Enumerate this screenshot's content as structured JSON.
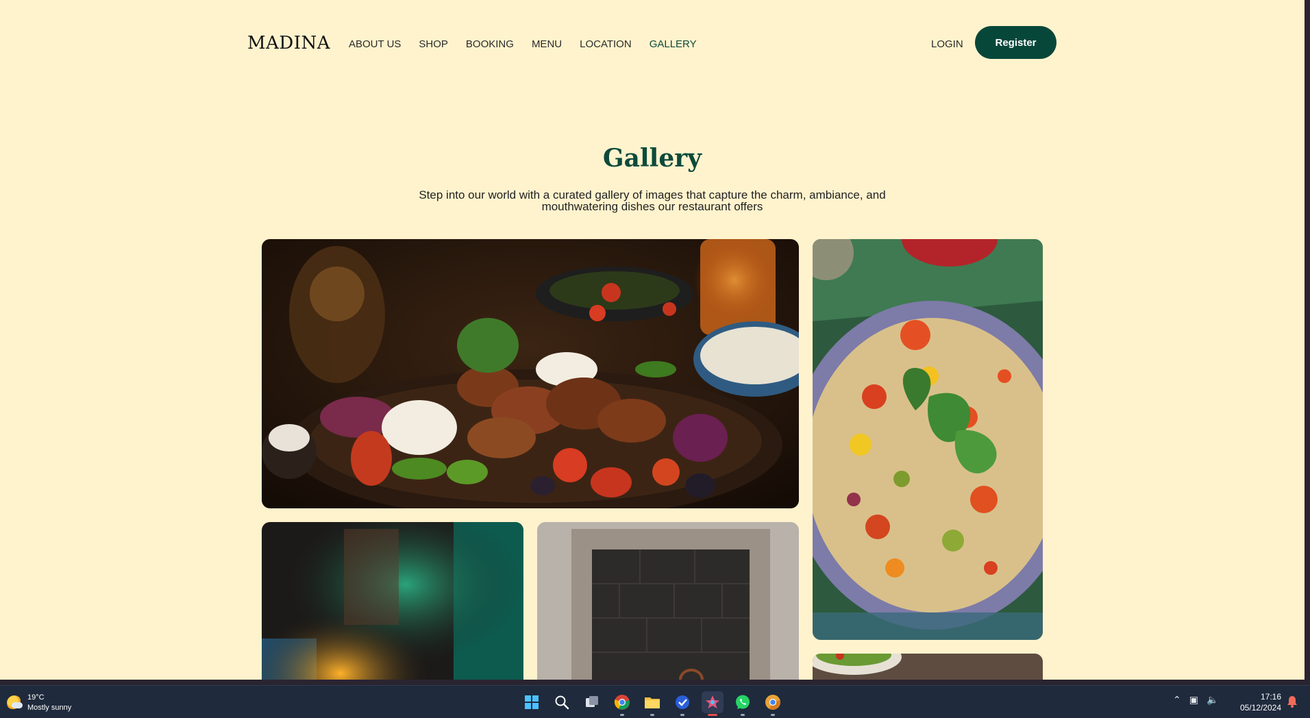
{
  "nav": {
    "logo": "MADINA",
    "links": [
      "ABOUT US",
      "SHOP",
      "BOOKING",
      "MENU",
      "LOCATION",
      "GALLERY"
    ],
    "active": "GALLERY",
    "login": "LOGIN",
    "register": "Register"
  },
  "gallery": {
    "title": "Gallery",
    "subtitle_line1": "Step into our world with a curated gallery of images that capture the charm, ambiance, and",
    "subtitle_line2": "mouthwatering dishes our restaurant offers",
    "images": [
      "grilled-kebab-platter-image",
      "couscous-salad-image",
      "blurred-interior-image",
      "stone-fireplace-image",
      "table-dish-image"
    ]
  },
  "colors": {
    "page_bg": "#fff3cd",
    "accent": "#07473a",
    "title": "#0d4a3c",
    "taskbar": "#1f2a3c"
  },
  "taskbar": {
    "weather_temp": "19°C",
    "weather_desc": "Mostly sunny",
    "apps": [
      "start-icon",
      "search-icon",
      "task-view-icon",
      "chrome-icon",
      "file-explorer-icon",
      "todo-icon",
      "paint-icon",
      "whatsapp-icon",
      "chrome-canary-icon"
    ],
    "active_app": "paint-icon",
    "time": "17:16",
    "date": "05/12/2024"
  }
}
